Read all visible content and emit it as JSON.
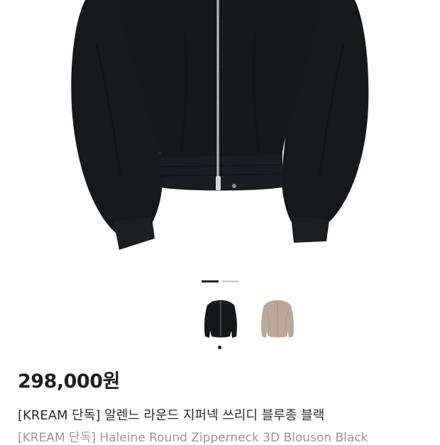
{
  "product": {
    "price": "298,000원",
    "title_ko": "[KREAM 단독] 알렌느 라운드 지퍼넥 쓰리디 블루종 블랙",
    "title_en": "[KREAM 단독] Haleine Round Zipperneck 3D Blouson Black"
  },
  "gallery": {
    "total_images": 2,
    "active_index": 0
  },
  "thumbnails": [
    {
      "color": "black",
      "selected": true
    },
    {
      "color": "beige",
      "selected": false
    }
  ],
  "colors": {
    "jacket_black": "#16171b",
    "jacket_beige": "#bca898",
    "indicator_active": "#222222",
    "indicator_inactive": "#d4d4d4",
    "price_text": "#1f1f1f",
    "subtitle_text": "#9a9a9a"
  }
}
